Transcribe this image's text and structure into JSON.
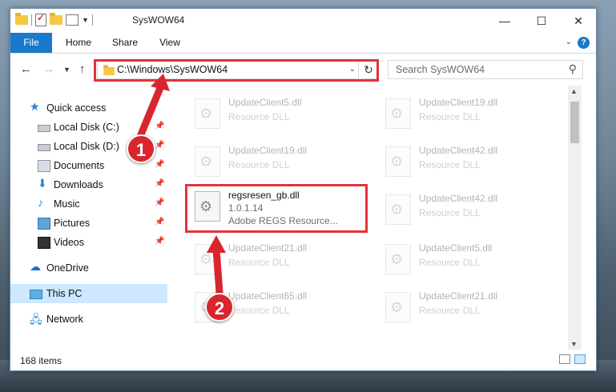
{
  "window": {
    "title": "SysWOW64",
    "minimize_glyph": "—",
    "maximize_glyph": "☐",
    "close_glyph": "✕"
  },
  "ribbon": {
    "tabs": [
      "File",
      "Home",
      "Share",
      "View"
    ],
    "help_glyph": "?"
  },
  "address": {
    "path": "C:\\Windows\\SysWOW64",
    "search_placeholder": "Search SysWOW64"
  },
  "nav": {
    "items": [
      {
        "label": "Quick access",
        "icon": "star-icon"
      },
      {
        "label": "Local Disk (C:)",
        "icon": "drive-icon",
        "pinned": true
      },
      {
        "label": "Local Disk (D:)",
        "icon": "drive-icon",
        "pinned": true
      },
      {
        "label": "Documents",
        "icon": "documents-icon",
        "pinned": true
      },
      {
        "label": "Downloads",
        "icon": "download-icon",
        "pinned": true
      },
      {
        "label": "Music",
        "icon": "music-icon",
        "pinned": true
      },
      {
        "label": "Pictures",
        "icon": "pictures-icon",
        "pinned": true
      },
      {
        "label": "Videos",
        "icon": "videos-icon",
        "pinned": true
      },
      {
        "label": "OneDrive",
        "icon": "cloud-icon"
      },
      {
        "label": "This PC",
        "icon": "computer-icon",
        "selected": true
      },
      {
        "label": "Network",
        "icon": "network-icon"
      }
    ]
  },
  "files": {
    "left_column": [
      {
        "name": "UpdateClient5.dll",
        "desc": "Resource DLL"
      },
      {
        "name": "UpdateClient19.dll",
        "desc": "Resource DLL"
      },
      {
        "name": "regsresen_gb.dll",
        "version": "1.0.1.14",
        "desc": "Adobe REGS Resource..."
      },
      {
        "name": "UpdateClient21.dll",
        "desc": "Resource DLL"
      },
      {
        "name": "UpdateClient65.dll",
        "desc": "Resource DLL"
      }
    ],
    "right_column": [
      {
        "name": "UpdateClient19.dll",
        "desc": "Resource DLL"
      },
      {
        "name": "UpdateClient42.dll",
        "desc": "Resource DLL"
      },
      {
        "name": "UpdateClient42.dll",
        "desc": "Resource DLL"
      },
      {
        "name": "UpdateClient5.dll",
        "desc": "Resource DLL"
      },
      {
        "name": "UpdateClient21.dll",
        "desc": "Resource DLL"
      }
    ]
  },
  "status": {
    "item_count": "168 items"
  },
  "callouts": {
    "one": "1",
    "two": "2",
    "color": "#d9262e"
  }
}
